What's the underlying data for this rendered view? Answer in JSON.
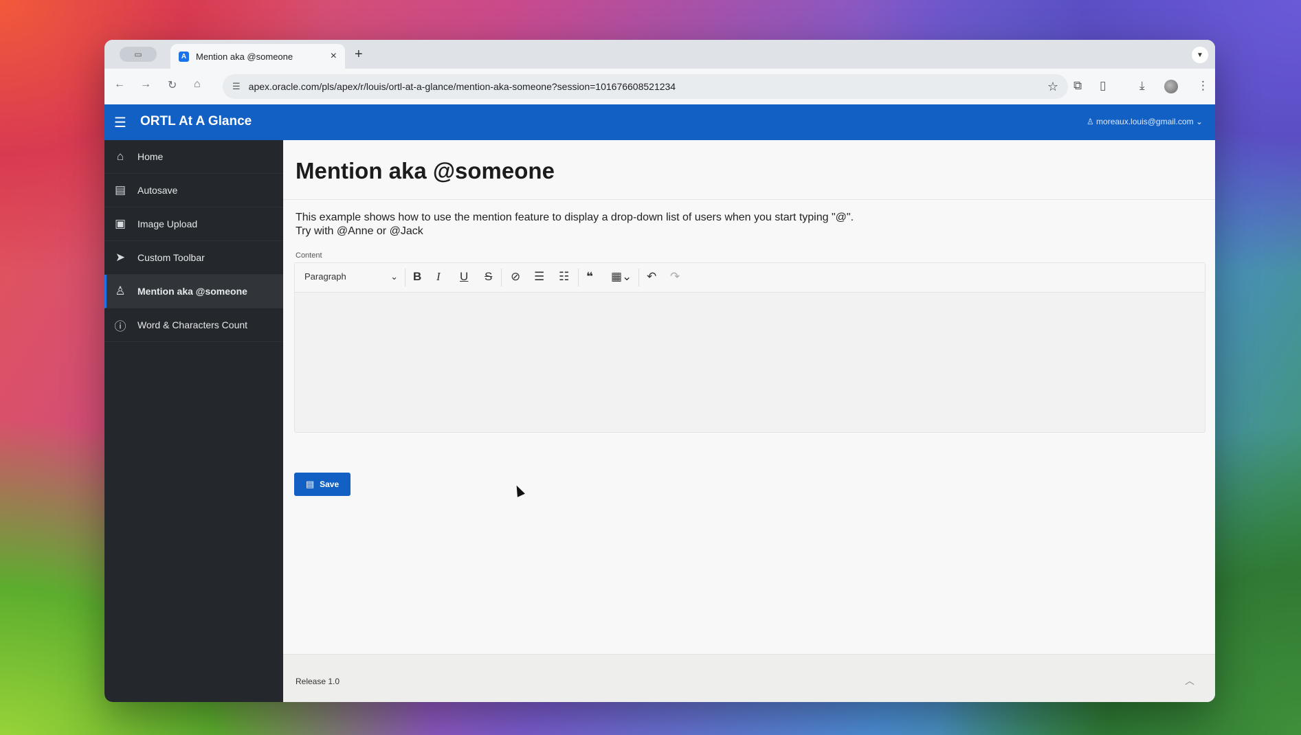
{
  "browser": {
    "tab_title": "Mention aka @someone",
    "favicon_letter": "A",
    "new_tab": "+",
    "tab_close": "×",
    "url": "apex.oracle.com/pls/apex/r/louis/ortl-at-a-glance/mention-aka-someone?session=101676608521234"
  },
  "header": {
    "app_title": "ORTL At A Glance",
    "user": "moreaux.louis@gmail.com"
  },
  "sidebar": {
    "items": [
      {
        "label": "Home",
        "icon": "home-icon",
        "glyph": "⌂"
      },
      {
        "label": "Autosave",
        "icon": "save-icon",
        "glyph": "▤"
      },
      {
        "label": "Image Upload",
        "icon": "image-icon",
        "glyph": "▣"
      },
      {
        "label": "Custom Toolbar",
        "icon": "pointer-icon",
        "glyph": "➤"
      },
      {
        "label": "Mention aka @someone",
        "icon": "user-icon",
        "glyph": "♙",
        "active": true
      },
      {
        "label": "Word & Characters Count",
        "icon": "info-circle-icon",
        "glyph": "ⓘ"
      }
    ]
  },
  "main": {
    "page_title": "Mention aka @someone",
    "description_line1": "This example shows how to use the mention feature to display a drop-down list of users when you start typing \"@\".",
    "description_line2": "Try with @Anne or @Jack",
    "content_label": "Content",
    "editor": {
      "block_format": "Paragraph",
      "value": ""
    },
    "save_label": "Save"
  },
  "footer": {
    "release": "Release 1.0"
  },
  "colors": {
    "brand": "#1360c4",
    "sidebar": "#24272b"
  }
}
